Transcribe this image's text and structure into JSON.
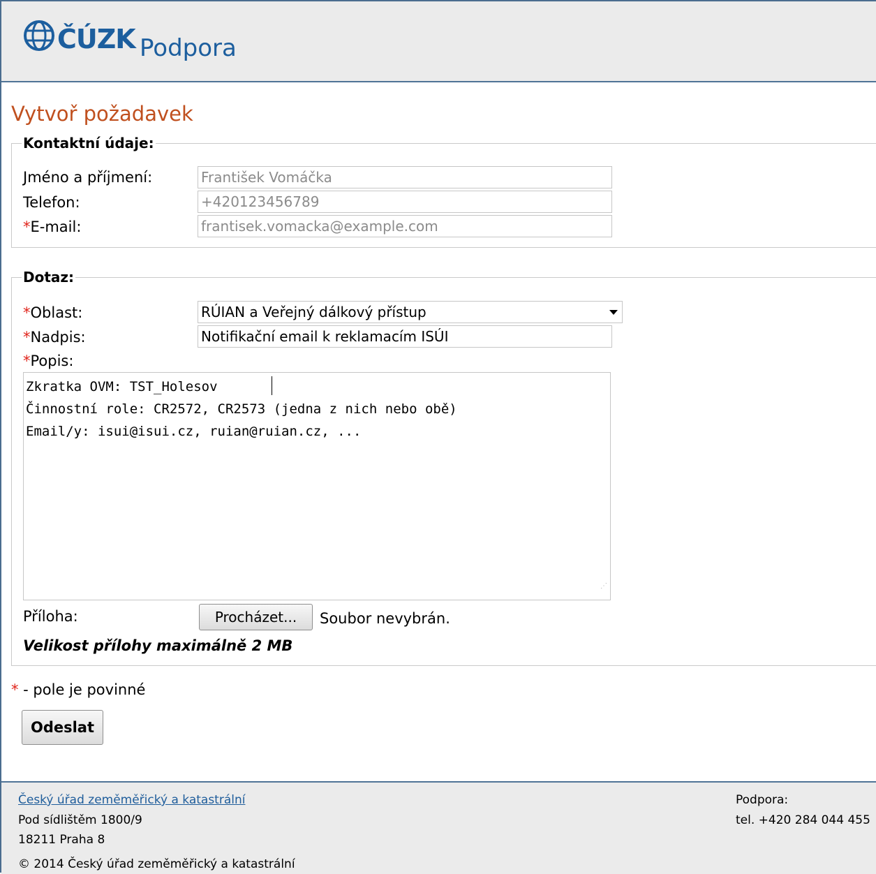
{
  "header": {
    "logo_text": "ČÚZK",
    "subtitle": "Podpora"
  },
  "page_title": "Vytvoř požadavek",
  "contact": {
    "legend": "Kontaktní údaje:",
    "name_label": "Jméno a příjmení:",
    "name_placeholder": "František Vomáčka",
    "phone_label": "Telefon:",
    "phone_placeholder": "+420123456789",
    "email_required": "*",
    "email_label": "E-mail:",
    "email_placeholder": "frantisek.vomacka@example.com"
  },
  "query": {
    "legend": "Dotaz:",
    "area_required": "*",
    "area_label": "Oblast:",
    "area_value": "RÚIAN a Veřejný dálkový přístup",
    "subject_required": "*",
    "subject_label": "Nadpis:",
    "subject_value": "Notifikační email k reklamacím ISÚI",
    "description_required": "*",
    "description_label": "Popis:",
    "description_lines": [
      "Zkratka OVM: TST_Holesov",
      "Činnostní role: CR2572, CR2573 (jedna z nich nebo obě)",
      "Email/y: isui@isui.cz, ruian@ruian.cz, ..."
    ],
    "attachment_label": "Příloha:",
    "browse_button": "Procházet...",
    "no_file_text": "Soubor nevybrán.",
    "size_note": "Velikost přílohy maximálně 2 MB"
  },
  "required_note": {
    "star": "*",
    "text": " - pole je povinné"
  },
  "submit_button": "Odeslat",
  "footer": {
    "org_link": "Český úřad zeměměřický a katastrální",
    "address_line1": "Pod sídlištěm 1800/9",
    "address_line2": "18211 Praha 8",
    "copyright": "© 2014 Český úřad zeměměřický a katastrální",
    "support_label": "Podpora:",
    "support_phone": "tel. +420 284 044 455"
  },
  "colors": {
    "title": "#c0501f",
    "required": "#e0241b",
    "link": "#1f5d9b",
    "logo": "#1c5e9e"
  }
}
